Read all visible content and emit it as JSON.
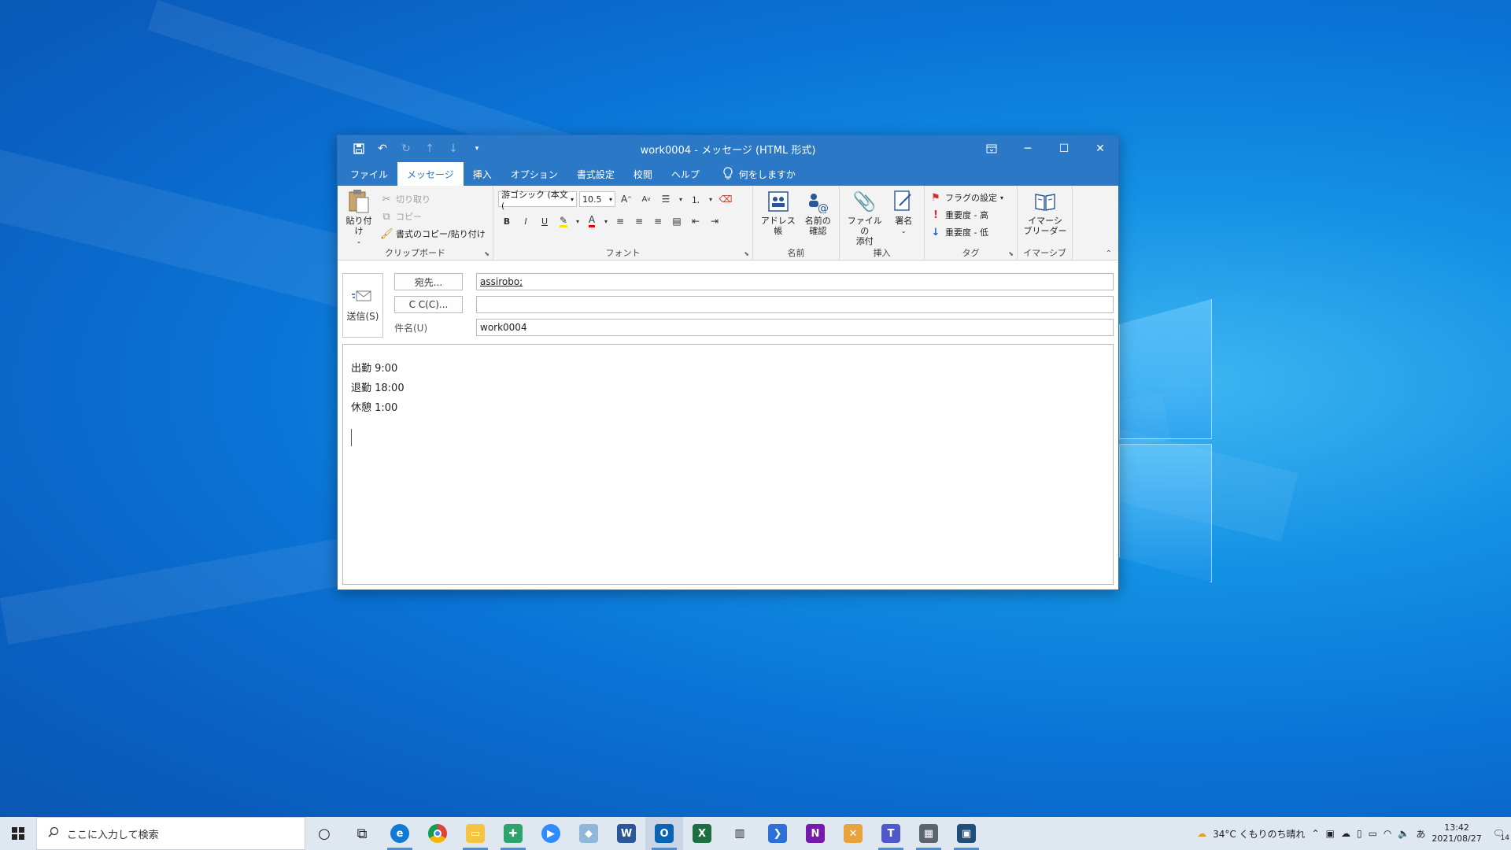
{
  "window": {
    "title": "work0004  -  メッセージ (HTML 形式)",
    "qat": [
      "save-icon",
      "undo-icon",
      "redo-icon",
      "up-icon",
      "down-icon",
      "customize-icon"
    ]
  },
  "tabs": [
    "ファイル",
    "メッセージ",
    "挿入",
    "オプション",
    "書式設定",
    "校閲",
    "ヘルプ"
  ],
  "active_tab": "メッセージ",
  "tell_me": "何をしますか",
  "ribbon": {
    "clipboard": {
      "label": "クリップボード",
      "paste": "貼り付け",
      "cut": "切り取り",
      "copy": "コピー",
      "format_painter": "書式のコピー/貼り付け"
    },
    "font": {
      "label": "フォント",
      "font_name": "游ゴシック (本文(",
      "font_size": "10.5",
      "bold": "B",
      "italic": "I",
      "underline": "U"
    },
    "names": {
      "label": "名前",
      "address_book": "アドレス帳",
      "check_names_1": "名前の",
      "check_names_2": "確認"
    },
    "include": {
      "label": "挿入",
      "attach_1": "ファイルの",
      "attach_2": "添付",
      "signature": "署名"
    },
    "tags": {
      "label": "タグ",
      "follow_up": "フラグの設定",
      "high": "重要度 - 高",
      "low": "重要度 - 低"
    },
    "immersive": {
      "label": "イマーシブ",
      "reader_1": "イマーシ",
      "reader_2": "ブリーダー"
    }
  },
  "compose": {
    "send": "送信(S)",
    "to_button": "宛先...",
    "cc_button": "C C(C)...",
    "subject_label": "件名(U)",
    "to_value": "assirobo;",
    "cc_value": "",
    "subject_value": "work0004"
  },
  "body_lines": [
    "出勤 9:00",
    "退勤 18:00",
    "休憩 1:00"
  ],
  "taskbar": {
    "search_placeholder": "ここに入力して検索",
    "weather": "34°C  くもりのち晴れ",
    "ime": "あ",
    "time": "13:42",
    "date": "2021/08/27",
    "notifications": "14"
  },
  "colors": {
    "accent": "#2b78c6",
    "desktop": "#0a74d6"
  }
}
